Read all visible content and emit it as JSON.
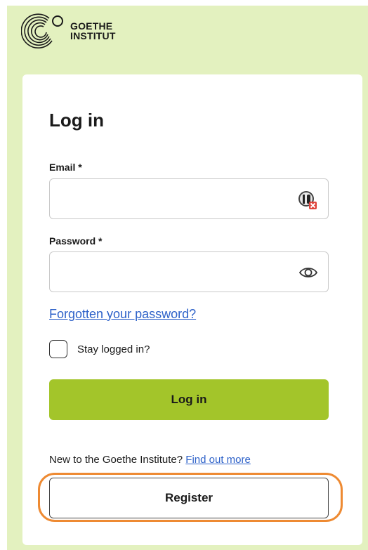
{
  "brand": {
    "logo_line1": "GOETHE",
    "logo_line2": "INSTITUT",
    "logo_icon": "goethe-institut-logo"
  },
  "form": {
    "title": "Log in",
    "email": {
      "label": "Email *",
      "value": "",
      "placeholder": ""
    },
    "password": {
      "label": "Password *",
      "value": "",
      "placeholder": ""
    },
    "forgot_link": "Forgotten your password?",
    "stay_logged_in": {
      "label": "Stay logged in?",
      "checked": false
    },
    "login_button": "Log in"
  },
  "register": {
    "prompt": "New to the Goethe Institute?",
    "find_out_more": "Find out more",
    "button": "Register"
  },
  "colors": {
    "background": "#e3f1bf",
    "primary_button": "#a3c52a",
    "link": "#2e62c9",
    "highlight": "#ee8a32"
  }
}
